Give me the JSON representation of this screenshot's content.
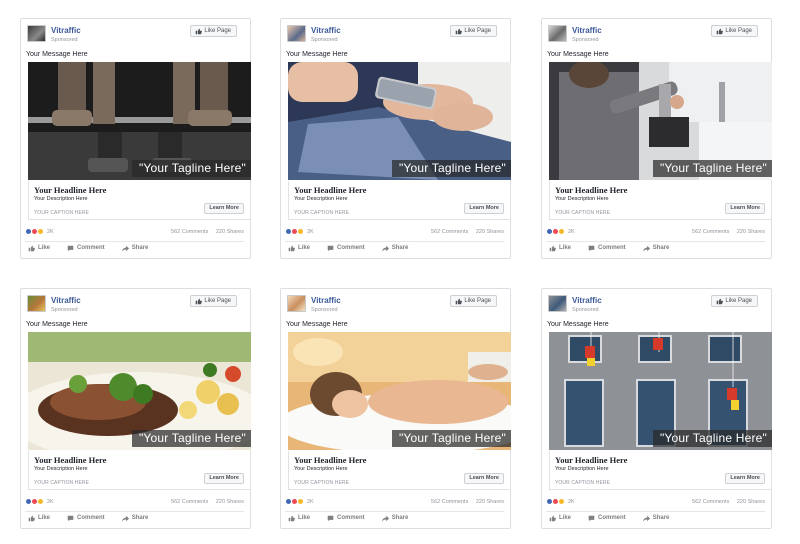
{
  "ads": [
    {
      "page_name": "Vitraffic",
      "sponsored": "Sponsored",
      "like_page": "Like Page",
      "message": "Your Message Here",
      "tagline": "\"Your Tagline Here\"",
      "headline": "Your Headline Here",
      "description": "Your Description Here",
      "caption": "YOUR CAPTION HERE",
      "learn_more": "Learn More",
      "reaction_count": "2K",
      "comments": "562 Comments",
      "shares": "220 Shares",
      "actions": {
        "like": "Like",
        "comment": "Comment",
        "share": "Share"
      }
    },
    {
      "page_name": "Vitraffic",
      "sponsored": "Sponsored",
      "like_page": "Like Page",
      "message": "Your Message Here",
      "tagline": "\"Your Tagline Here\"",
      "headline": "Your Headline Here",
      "description": "Your Description Here",
      "caption": "YOUR CAPTION HERE",
      "learn_more": "Learn More",
      "reaction_count": "2K",
      "comments": "562 Comments",
      "shares": "220 Shares",
      "actions": {
        "like": "Like",
        "comment": "Comment",
        "share": "Share"
      }
    },
    {
      "page_name": "Vitraffic",
      "sponsored": "Sponsored",
      "like_page": "Like Page",
      "message": "Your Message Here",
      "tagline": "\"Your Tagline Here\"",
      "headline": "Your Headline Here",
      "description": "Your Description Here",
      "caption": "YOUR CAPTION HERE",
      "learn_more": "Learn More",
      "reaction_count": "2K",
      "comments": "562 Comments",
      "shares": "220 Shares",
      "actions": {
        "like": "Like",
        "comment": "Comment",
        "share": "Share"
      }
    },
    {
      "page_name": "Vitraffic",
      "sponsored": "Sponsored",
      "like_page": "Like Page",
      "message": "Your Message Here",
      "tagline": "\"Your Tagline Here\"",
      "headline": "Your Headline Here",
      "description": "Your Description Here",
      "caption": "YOUR CAPTION HERE",
      "learn_more": "Learn More",
      "reaction_count": "2K",
      "comments": "562 Comments",
      "shares": "220 Shares",
      "actions": {
        "like": "Like",
        "comment": "Comment",
        "share": "Share"
      }
    },
    {
      "page_name": "Vitraffic",
      "sponsored": "Sponsored",
      "like_page": "Like Page",
      "message": "Your Message Here",
      "tagline": "\"Your Tagline Here\"",
      "headline": "Your Headline Here",
      "description": "Your Description Here",
      "caption": "YOUR CAPTION HERE",
      "learn_more": "Learn More",
      "reaction_count": "2K",
      "comments": "562 Comments",
      "shares": "220 Shares",
      "actions": {
        "like": "Like",
        "comment": "Comment",
        "share": "Share"
      }
    },
    {
      "page_name": "Vitraffic",
      "sponsored": "Sponsored",
      "like_page": "Like Page",
      "message": "Your Message Here",
      "tagline": "\"Your Tagline Here\"",
      "headline": "Your Headline Here",
      "description": "Your Description Here",
      "caption": "YOUR CAPTION HERE",
      "learn_more": "Learn More",
      "reaction_count": "2K",
      "comments": "562 Comments",
      "shares": "220 Shares",
      "actions": {
        "like": "Like",
        "comment": "Comment",
        "share": "Share"
      }
    }
  ],
  "colors": {
    "brand": "#3b5998",
    "like_reaction": "#4267b2",
    "love_reaction": "#ed4956",
    "wow_reaction": "#f7b928",
    "muted_text": "#90949c"
  },
  "icons": {
    "like_page": "thumbs-up-icon",
    "like_action": "thumbs-up-icon",
    "comment_action": "speech-bubble-icon",
    "share_action": "share-arrow-icon",
    "reactions": [
      "like-reaction-icon",
      "love-reaction-icon",
      "wow-reaction-icon"
    ]
  },
  "images": [
    "weightlifter-hands-on-barbell",
    "hands-holding-phone-over-laptop",
    "plumber-repairing-sink",
    "plated-meat-with-vegetables",
    "woman-relaxing-at-spa",
    "window-cleaners-on-building"
  ]
}
